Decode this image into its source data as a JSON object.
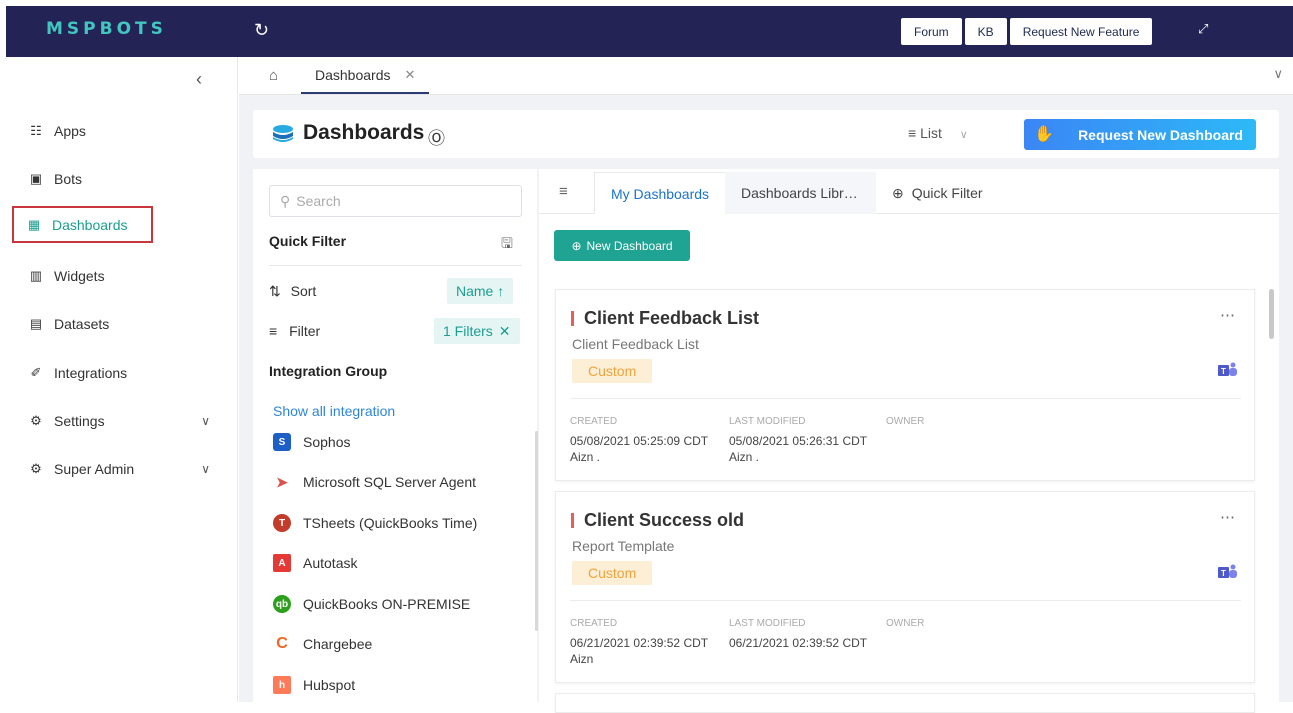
{
  "topbar": {
    "logo": "MSPBOTS",
    "buttons": [
      "Forum",
      "KB",
      "Request New Feature"
    ]
  },
  "sidebar": {
    "items": [
      {
        "label": "Apps",
        "icon": "apps-icon"
      },
      {
        "label": "Bots",
        "icon": "bots-icon"
      },
      {
        "label": "Dashboards",
        "icon": "dashboards-icon",
        "active": true
      },
      {
        "label": "Widgets",
        "icon": "widgets-icon"
      },
      {
        "label": "Datasets",
        "icon": "datasets-icon"
      },
      {
        "label": "Integrations",
        "icon": "integrations-icon"
      },
      {
        "label": "Settings",
        "icon": "settings-icon",
        "expandable": true
      },
      {
        "label": "Super Admin",
        "icon": "super-admin-icon",
        "expandable": true
      }
    ]
  },
  "tabs": {
    "open_tab": "Dashboards"
  },
  "header": {
    "title": "Dashboards",
    "view_mode": "List",
    "request_button": "Request New Dashboard"
  },
  "filter_panel": {
    "search_placeholder": "Search",
    "quick_filter_title": "Quick Filter",
    "sort_label": "Sort",
    "sort_value": "Name ↑",
    "filter_label": "Filter",
    "filter_value": "1 Filters",
    "integration_group_title": "Integration Group",
    "show_all": "Show all integration",
    "integrations": [
      {
        "name": "Sophos",
        "icon": "sophos-icon",
        "color": "#1c5fc7"
      },
      {
        "name": "Microsoft SQL Server Agent",
        "icon": "sql-server-agent-icon",
        "color": "#d9534f"
      },
      {
        "name": "TSheets (QuickBooks Time)",
        "icon": "tsheets-icon",
        "color": "#c33b2a"
      },
      {
        "name": "Autotask",
        "icon": "autotask-icon",
        "color": "#e53935"
      },
      {
        "name": "QuickBooks ON-PREMISE",
        "icon": "quickbooks-icon",
        "color": "#2ca01c"
      },
      {
        "name": "Chargebee",
        "icon": "chargebee-icon",
        "color": "#f26522"
      },
      {
        "name": "Hubspot",
        "icon": "hubspot-icon",
        "color": "#ff7a59"
      }
    ]
  },
  "list_panel": {
    "tabs": [
      "My Dashboards",
      "Dashboards Libr…",
      "Quick Filter"
    ],
    "new_button": "New Dashboard",
    "meta_labels": {
      "created": "CREATED",
      "modified": "LAST MODIFIED",
      "owner": "OWNER"
    },
    "cards": [
      {
        "title": "Client Feedback List",
        "subtitle": "Client Feedback List",
        "tag": "Custom",
        "created": "05/08/2021 05:25:09 CDT",
        "created_by": "Aizn .",
        "modified": "05/08/2021 05:26:31 CDT",
        "modified_by": "Aizn ."
      },
      {
        "title": "Client Success old",
        "subtitle": "Report Template",
        "tag": "Custom",
        "created": "06/21/2021 02:39:52 CDT",
        "created_by": "Aizn",
        "modified": "06/21/2021 02:39:52 CDT",
        "modified_by": ""
      }
    ]
  },
  "colors": {
    "topbar": "#232356",
    "accent": "#1fa393",
    "link": "#2d86d8",
    "tag_bg": "#fdefd6",
    "tag_text": "#f0a23b",
    "active_outline": "#c9363c"
  }
}
